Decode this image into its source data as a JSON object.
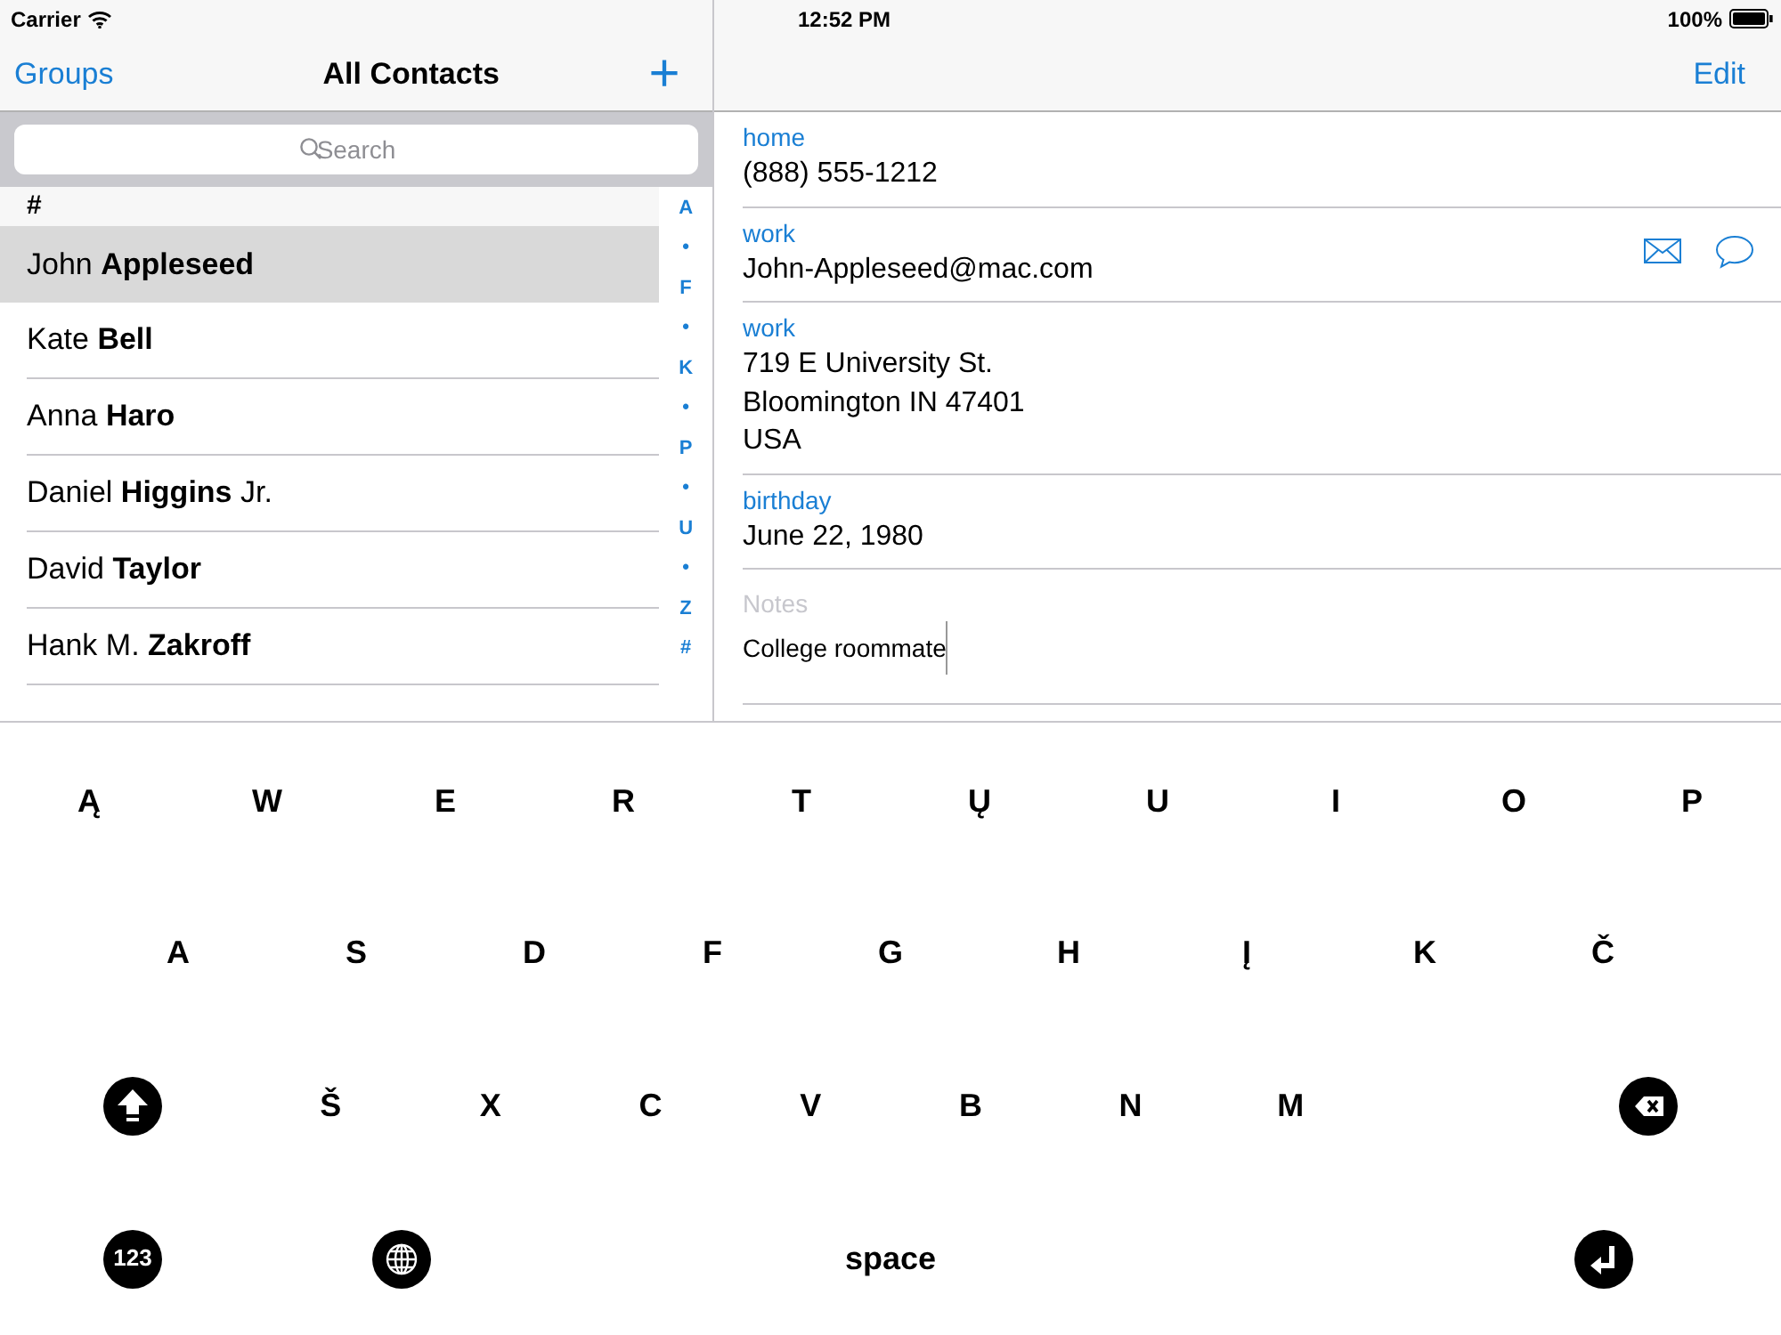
{
  "status_bar": {
    "carrier": "Carrier",
    "time": "12:52 PM",
    "battery": "100%"
  },
  "contacts_nav": {
    "left": "Groups",
    "title": "All Contacts",
    "add": "+"
  },
  "search": {
    "placeholder": "Search"
  },
  "section_header": "#",
  "contacts": [
    {
      "name": "John **Appleseed**",
      "selected": true
    },
    {
      "name": "Kate **Bell**",
      "selected": false
    },
    {
      "name": "Anna **Haro**",
      "selected": false
    },
    {
      "name": "Daniel **Higgins** Jr.",
      "selected": false
    },
    {
      "name": "David **Taylor**",
      "selected": false
    },
    {
      "name": "Hank M. **Zakroff**",
      "selected": false
    }
  ],
  "index": [
    "A",
    "•",
    "F",
    "•",
    "K",
    "•",
    "P",
    "•",
    "U",
    "•",
    "Z",
    "#"
  ],
  "detail_nav": {
    "right": "Edit"
  },
  "fields": [
    {
      "kind": "plain",
      "label": "home",
      "lines": [
        "(888) 555-1212"
      ]
    },
    {
      "kind": "email",
      "label": "work",
      "lines": [
        "John-Appleseed@mac.com"
      ]
    },
    {
      "kind": "plain",
      "label": "work",
      "lines": [
        "719 E University St.",
        "Bloomington IN 47401",
        "USA"
      ]
    },
    {
      "kind": "plain",
      "label": "birthday",
      "lines": [
        "June 22, 1980"
      ]
    },
    {
      "kind": "notes",
      "label": "Notes",
      "lines": [
        "College roommate"
      ]
    }
  ],
  "keyboard": [
    [
      {
        "kind": "char",
        "label": "Ą"
      },
      {
        "kind": "char",
        "label": "W"
      },
      {
        "kind": "char",
        "label": "E"
      },
      {
        "kind": "char",
        "label": "R"
      },
      {
        "kind": "char",
        "label": "T"
      },
      {
        "kind": "char",
        "label": "Ų"
      },
      {
        "kind": "char",
        "label": "U"
      },
      {
        "kind": "char",
        "label": "I"
      },
      {
        "kind": "char",
        "label": "O"
      },
      {
        "kind": "char",
        "label": "P"
      }
    ],
    [
      {
        "kind": "char",
        "label": "A"
      },
      {
        "kind": "char",
        "label": "S"
      },
      {
        "kind": "char",
        "label": "D"
      },
      {
        "kind": "char",
        "label": "F"
      },
      {
        "kind": "char",
        "label": "G"
      },
      {
        "kind": "char",
        "label": "H"
      },
      {
        "kind": "char",
        "label": "Į"
      },
      {
        "kind": "char",
        "label": "K"
      },
      {
        "kind": "char",
        "label": "Č"
      }
    ],
    [
      {
        "kind": "shift"
      },
      {
        "kind": "char",
        "label": "Š"
      },
      {
        "kind": "char",
        "label": "X"
      },
      {
        "kind": "char",
        "label": "C"
      },
      {
        "kind": "char",
        "label": "V"
      },
      {
        "kind": "char",
        "label": "B"
      },
      {
        "kind": "char",
        "label": "N"
      },
      {
        "kind": "char",
        "label": "M"
      },
      {
        "kind": "backspace"
      }
    ],
    [
      {
        "kind": "numbers",
        "label": "123"
      },
      {
        "kind": "globe"
      },
      {
        "kind": "space",
        "label": "space"
      },
      {
        "kind": "return"
      }
    ]
  ]
}
